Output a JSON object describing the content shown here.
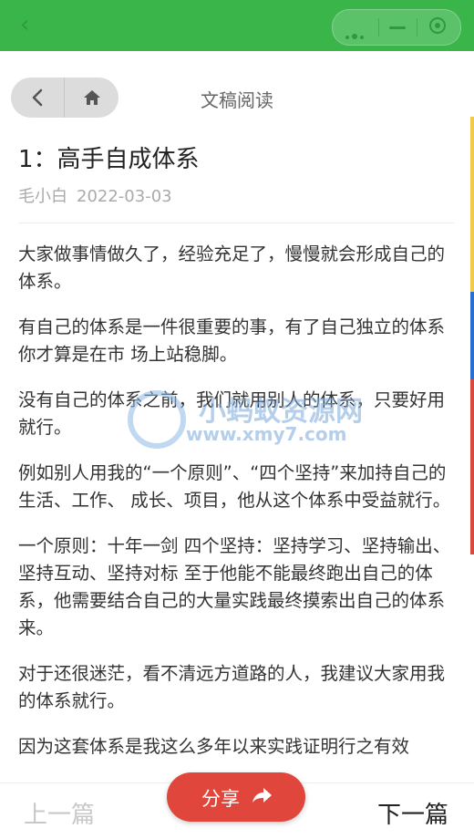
{
  "topbar": {
    "back_icon": "chevron-left-icon",
    "menu_icon": "more-dots-icon",
    "minimize_icon": "minus-icon",
    "close_icon": "target-circle-icon"
  },
  "nav": {
    "title": "文稿阅读",
    "back_icon": "chevron-left-icon",
    "home_icon": "home-icon"
  },
  "article": {
    "title": "1：高手自成体系",
    "author": "毛小白",
    "date": "2022-03-03",
    "paragraphs": [
      "大家做事情做久了，经验充足了，慢慢就会形成自己的体系。",
      "有自己的体系是一件很重要的事，有了自己独立的体系你才算是在市 场上站稳脚。",
      "没有自己的体系之前，我们就用别人的体系，只要好用就行。",
      "例如别人用我的“一个原则”、“四个坚持”来加持自己的生活、工作、 成长、项目，他从这个体系中受益就行。",
      "一个原则：十年一剑 四个坚持：坚持学习、坚持输出、坚持互动、坚持对标 至于他能不能最终跑出自己的体系，他需要结合自己的大量实践最终摸索出自己的体系来。",
      "对于还很迷茫，看不清远方道路的人，我建议大家用我的体系就行。",
      "因为这套体系是我这么多年以来实践证明行之有效"
    ]
  },
  "watermark": {
    "line1": "小蚂蚁资源网",
    "line2": "www.xmy7.com"
  },
  "bottom": {
    "prev": "上一篇",
    "next": "下一篇",
    "share": "分享",
    "share_icon": "arrow-right-icon"
  },
  "colors": {
    "topbar": "#39b54a",
    "share_button": "#e0463c"
  }
}
